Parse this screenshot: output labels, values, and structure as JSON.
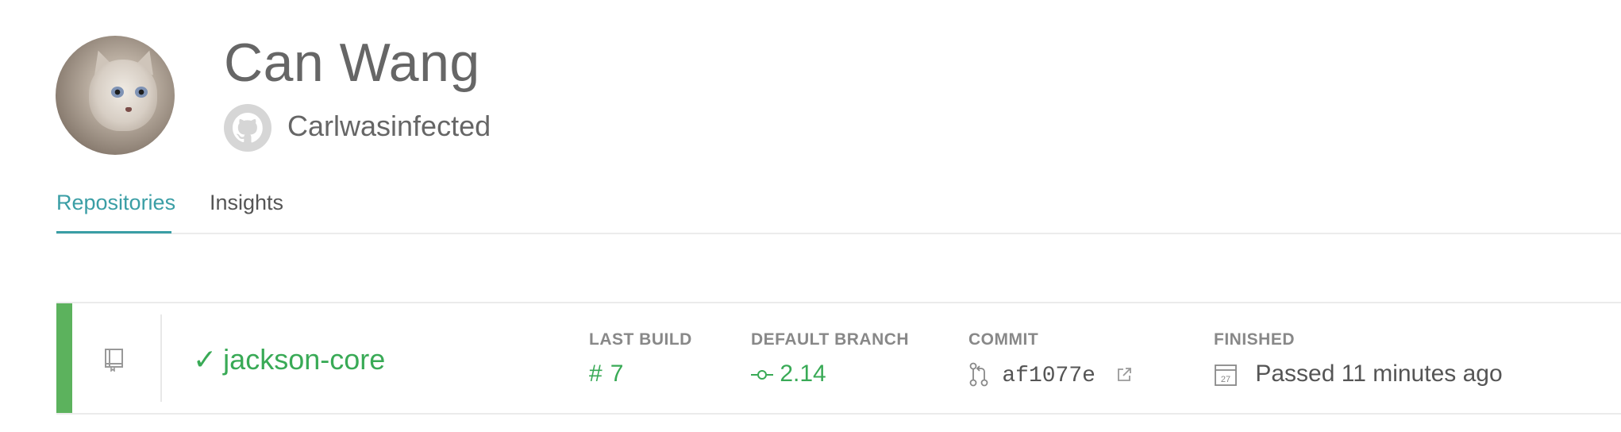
{
  "profile": {
    "name": "Can Wang",
    "username": "Carlwasinfected"
  },
  "tabs": [
    {
      "label": "Repositories",
      "active": true
    },
    {
      "label": "Insights",
      "active": false
    }
  ],
  "repository": {
    "status": "passed",
    "name": "jackson-core",
    "check_glyph": "✓",
    "last_build": {
      "label": "LAST BUILD",
      "glyph": "#",
      "number": "7"
    },
    "default_branch": {
      "label": "DEFAULT BRANCH",
      "value": "2.14"
    },
    "commit": {
      "label": "COMMIT",
      "sha": "af1077e"
    },
    "finished": {
      "label": "FINISHED",
      "value": "Passed 11 minutes ago",
      "calendar_day": "27"
    }
  },
  "colors": {
    "accent": "#3a9ea5",
    "passed": "#39aa56",
    "status_bar": "#5cb25d"
  },
  "icons": {
    "github": "github-icon",
    "repo": "repo-book-icon",
    "branch": "branch-icon",
    "commit": "pull-request-icon",
    "external": "external-link-icon",
    "calendar": "calendar-icon"
  }
}
